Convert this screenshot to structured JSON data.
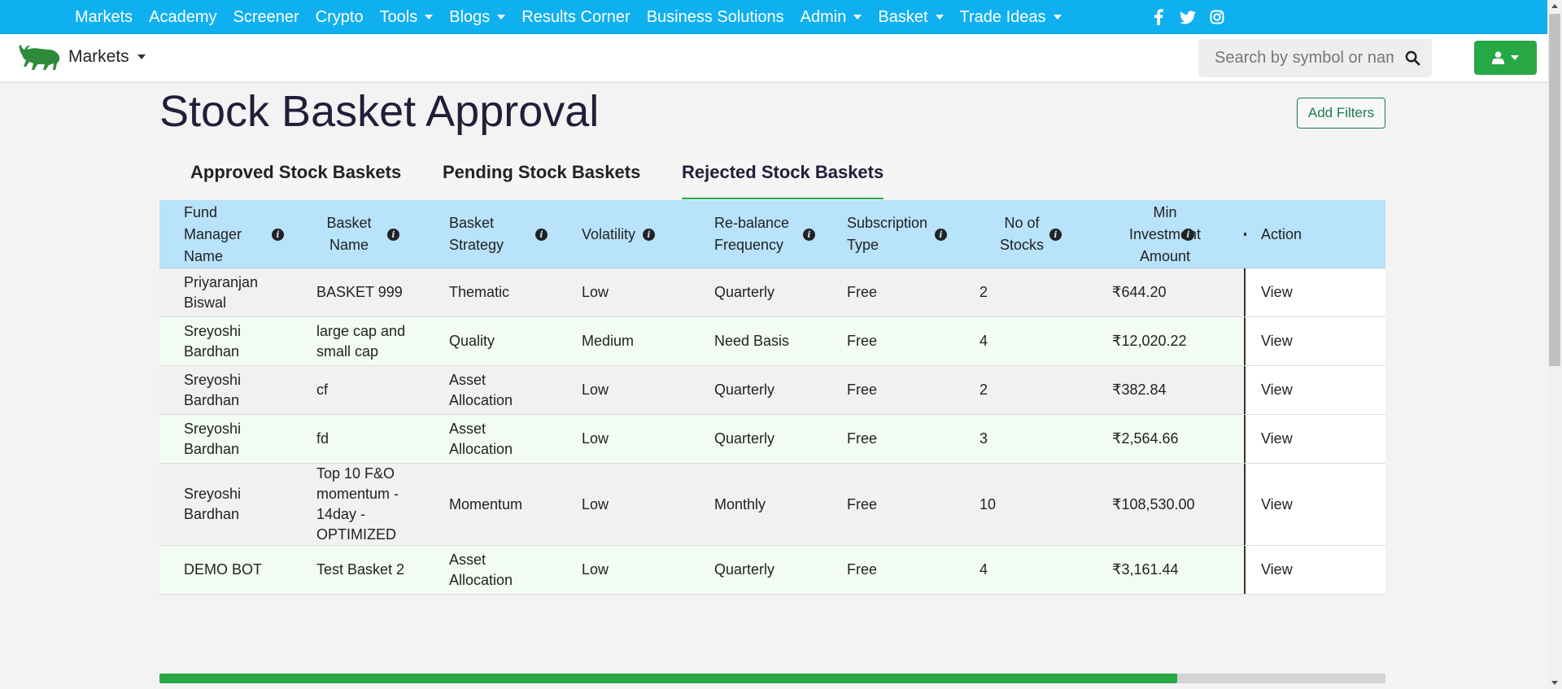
{
  "topnav": {
    "items": [
      {
        "label": "Markets",
        "dropdown": false
      },
      {
        "label": "Academy",
        "dropdown": false
      },
      {
        "label": "Screener",
        "dropdown": false
      },
      {
        "label": "Crypto",
        "dropdown": false
      },
      {
        "label": "Tools",
        "dropdown": true
      },
      {
        "label": "Blogs",
        "dropdown": true
      },
      {
        "label": "Results Corner",
        "dropdown": false
      },
      {
        "label": "Business Solutions",
        "dropdown": false
      },
      {
        "label": "Admin",
        "dropdown": true
      },
      {
        "label": "Basket",
        "dropdown": true
      },
      {
        "label": "Trade Ideas",
        "dropdown": true
      }
    ],
    "social": [
      "facebook-icon",
      "twitter-icon",
      "instagram-icon"
    ],
    "color": "#0fb0f0"
  },
  "subnav": {
    "brand_label": "Markets",
    "search_placeholder": "Search by symbol or name",
    "accent": "#28a745"
  },
  "page": {
    "title": "Stock Basket Approval",
    "add_filters_label": "Add Filters"
  },
  "tabs": [
    {
      "label": "Approved Stock Baskets",
      "active": false
    },
    {
      "label": "Pending Stock Baskets",
      "active": false
    },
    {
      "label": "Rejected Stock Baskets",
      "active": true
    }
  ],
  "table": {
    "columns": [
      {
        "label": "Fund Manager Name",
        "info": true
      },
      {
        "label": "Basket Name",
        "info": true
      },
      {
        "label": "Basket Strategy",
        "info": true
      },
      {
        "label": "Volatility",
        "info": true
      },
      {
        "label": "Re-balance Frequency",
        "info": true
      },
      {
        "label": "Subscription Type",
        "info": true
      },
      {
        "label": "No of Stocks",
        "info": true
      },
      {
        "label": "Min Investment Amount",
        "info": true
      },
      {
        "label": "Action",
        "info": false
      }
    ],
    "rows": [
      [
        "Priyaranjan Biswal",
        "BASKET 999",
        "Thematic",
        "Low",
        "Quarterly",
        "Free",
        "2",
        "₹644.20",
        "View"
      ],
      [
        "Sreyoshi Bardhan",
        "large cap and small cap",
        "Quality",
        "Medium",
        "Need Basis",
        "Free",
        "4",
        "₹12,020.22",
        "View"
      ],
      [
        "Sreyoshi Bardhan",
        "cf",
        "Asset Allocation",
        "Low",
        "Quarterly",
        "Free",
        "2",
        "₹382.84",
        "View"
      ],
      [
        "Sreyoshi Bardhan",
        "fd",
        "Asset Allocation",
        "Low",
        "Quarterly",
        "Free",
        "3",
        "₹2,564.66",
        "View"
      ],
      [
        "Sreyoshi Bardhan",
        "Top 10 F&O momentum - 14day - OPTIMIZED",
        "Momentum",
        "Low",
        "Monthly",
        "Free",
        "10",
        "₹108,530.00",
        "View"
      ],
      [
        "DEMO BOT",
        "Test Basket 2",
        "Asset Allocation",
        "Low",
        "Quarterly",
        "Free",
        "4",
        "₹3,161.44",
        "View"
      ]
    ]
  },
  "horizontal_scroll": {
    "position_fraction": 0.83
  }
}
